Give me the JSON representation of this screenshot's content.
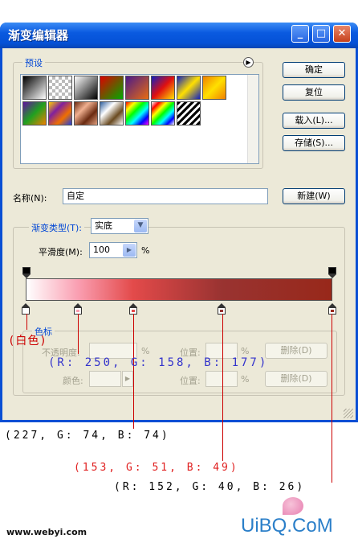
{
  "window": {
    "title": "渐变编辑器",
    "minimize_glyph": "_",
    "maximize_glyph": "□",
    "close_glyph": "✕"
  },
  "presets": {
    "legend": "预设",
    "menu_glyph": "▶",
    "swatch_icons": [
      "black-white",
      "transparent-checker",
      "black-transparent",
      "red-green",
      "violet-orange",
      "blue-red-yellow",
      "blue-yellow-blue",
      "orange-yellow-orange",
      "violet-green-orange",
      "yellow-violet-orange-blue",
      "copper",
      "chrome",
      "spectrum",
      "transparent-rainbow",
      "transparent-stripes"
    ]
  },
  "buttons": {
    "ok": "确定",
    "reset": "复位",
    "load": "载入(L)...",
    "save": "存储(S)...",
    "new": "新建(W)"
  },
  "name": {
    "label": "名称(N):",
    "value": "自定"
  },
  "gradient": {
    "type_label": "渐变类型(T):",
    "type_value": "实底",
    "smoothness_label": "平滑度(M):",
    "smoothness_value": "100",
    "smoothness_unit": "%",
    "color_stops": [
      {
        "position": 0,
        "color": "#ffffff"
      },
      {
        "position": 17,
        "color": "#fa9eb1"
      },
      {
        "position": 35,
        "color": "#e34a4a"
      },
      {
        "position": 64,
        "color": "#993331"
      },
      {
        "position": 100,
        "color": "#98281a"
      }
    ]
  },
  "stops_group": {
    "legend": "色标",
    "opacity_label": "不透明度:",
    "opacity_unit": "%",
    "location_label": "位置:",
    "location_unit": "%",
    "delete_label": "删除(D)",
    "color_label": "颜色:",
    "location2_label": "位置:",
    "location2_unit": "%",
    "delete2_label": "删除(D)"
  },
  "annotations": {
    "white": "(白色)",
    "pink": "(R: 250, G: 158, B: 177)",
    "red": "(227, G: 74, B: 74)",
    "maroon": "(153, G: 51, B: 49)",
    "brown": "(R: 152, G: 40, B: 26)",
    "colors": {
      "white": "#cc0000",
      "pink": "#3333cc",
      "red": "#000000",
      "maroon": "#e02020",
      "brown": "#000000",
      "line": "#cc0000"
    }
  },
  "footer": {
    "site_left": "www.webyi.com",
    "site_right": "UiBQ.CoM"
  }
}
